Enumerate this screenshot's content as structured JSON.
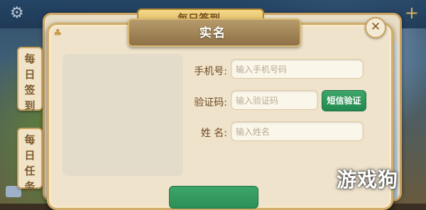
{
  "background": {
    "settings_icon": "gear-icon",
    "add_icon": "plus-icon"
  },
  "back_panel": {
    "title": "每日签到"
  },
  "side_tabs": [
    {
      "label": "每日签到"
    },
    {
      "label": "每日任务"
    }
  ],
  "dialog": {
    "title": "实名",
    "close_icon": "close-icon",
    "fields": {
      "phone": {
        "label": "手机号:",
        "placeholder": "输入手机号码"
      },
      "code": {
        "label": "验证码:",
        "placeholder": "输入验证码"
      },
      "name": {
        "label": "姓 名:",
        "placeholder": "输入姓名"
      }
    },
    "sms_button": "短信验证"
  },
  "watermark": "游戏狗",
  "colors": {
    "accent_green": "#2a8f56",
    "panel": "#efe3cb",
    "border_gold": "#d1ad6a"
  }
}
